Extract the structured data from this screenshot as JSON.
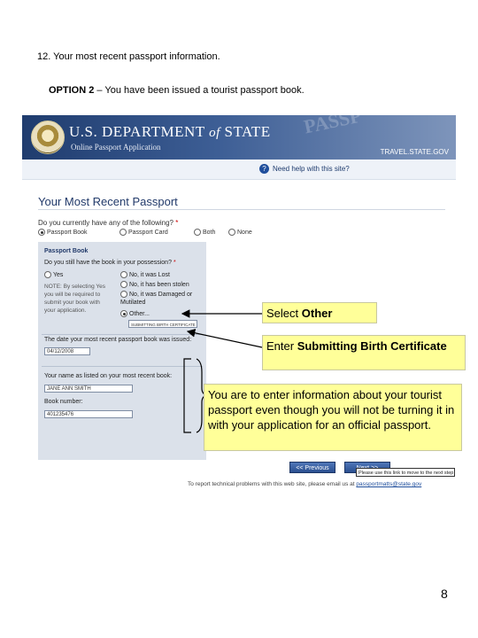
{
  "doc": {
    "heading": "12.  Your most recent passport information.",
    "option_label": "OPTION 2",
    "option_text": " – You have been issued a tourist passport book.",
    "page_number": "8"
  },
  "banner": {
    "dept_a": "U.S. DEPARTMENT ",
    "dept_of": "of",
    "dept_b": " STATE",
    "app_name": "Online Passport Application",
    "watermark": "PASSP",
    "site": "TRAVEL.STATE.GOV",
    "help_icon": "?",
    "help_text": "Need help with this site?"
  },
  "form": {
    "title": "Your Most Recent Passport",
    "q_have": "Do you currently have any of the following?",
    "required_mark": "*",
    "options_have": [
      "Passport Book",
      "Passport Card",
      "Both",
      "None"
    ],
    "box_title": "Passport Book",
    "q_possession": "Do you still have the book in your possession?",
    "yes_label": "Yes",
    "note": "NOTE: By selecting Yes you will be required to submit your book with your application.",
    "no_options": [
      "No, it was Lost",
      "No, it has been stolen",
      "No, it was Damaged or Mutilated",
      "Other..."
    ],
    "other_value": "SUBMITTING BIRTH CERTIFICATE",
    "date_label": "The date your most recent passport book was issued:",
    "date_value": "04/12/2008",
    "name_label": "Your name as listed on your most recent book:",
    "name_value": "JANE ANN SMITH",
    "book_label": "Book number:",
    "book_value": "401235476",
    "prev_button": "<< Previous",
    "next_button": "Next >>",
    "tooltip": "Please use this link to move to the next step",
    "footer_text": "To report technical problems with this web site, please email us at ",
    "footer_email": "passportmatts@state.gov"
  },
  "callouts": {
    "select_prefix": "Select ",
    "select_bold": "Other",
    "enter_prefix": "Enter ",
    "enter_bold": "Submitting Birth Certificate",
    "info": "You are to enter information about your tourist passport even though you will not be turning it in with your application for an official passport."
  },
  "colors": {
    "callout_fill": "#ffff99",
    "banner_navy": "#1f3c6e",
    "panel_gray": "#dbe1ea"
  }
}
